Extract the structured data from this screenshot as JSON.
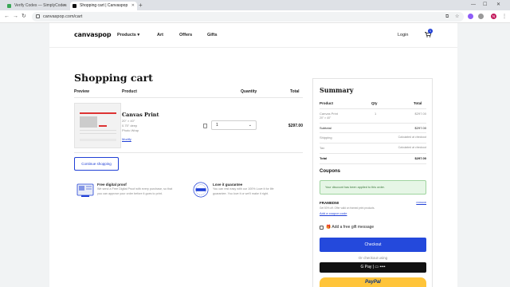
{
  "browser": {
    "tabs": [
      {
        "title": "Verify Codes — SimplyCodes",
        "active": false
      },
      {
        "title": "Shopping cart | Canvaspop",
        "active": true
      }
    ],
    "url": "canvaspop.com/cart",
    "profile_initial": "N"
  },
  "site": {
    "logo": "canvaspop",
    "nav": [
      "Products",
      "Art",
      "Offers",
      "Gifts"
    ],
    "login": "Login",
    "cart_count": "1"
  },
  "cart": {
    "title": "Shopping cart",
    "headers": {
      "preview": "Preview",
      "product": "Product",
      "quantity": "Quantity",
      "total": "Total"
    },
    "item": {
      "name": "Canvas Print",
      "size": "20\" × 40\"",
      "depth": "0.75\" deep",
      "wrap": "Photo Wrap",
      "modify": "Modify",
      "quantity": "1",
      "total": "$297.00"
    },
    "continue_label": "Continue shopping"
  },
  "features": [
    {
      "title": "Free digital proof",
      "line1": "We send a Free Digital Proof with every purchase, so that",
      "line2": "you can approve your order before it goes to print."
    },
    {
      "title": "Love it guarantee",
      "line1": "You can rest easy with our 100% Love it for life",
      "line2": "guarantee. You love it or we'll make it right."
    }
  ],
  "summary": {
    "title": "Summary",
    "headers": {
      "product": "Product",
      "qty": "Qty",
      "total": "Total"
    },
    "item": {
      "name": "Canvas Print",
      "size": "20\" × 40\"",
      "qty": "1",
      "total": "$297.00"
    },
    "subtotal_label": "Subtotal",
    "subtotal": "$297.00",
    "shipping_label": "Shipping",
    "shipping": "Calculated at checkout",
    "tax_label": "Tax",
    "tax": "Calculated at checkout",
    "total_label": "Total",
    "total": "$297.00"
  },
  "coupons": {
    "title": "Coupons",
    "alert": "Your discount has been applied to this order.",
    "code": "FRAMED50",
    "remove": "remove",
    "description": "Get 50% off. Offer valid on framed print products.",
    "add_link": "Add a coupon code"
  },
  "gift_label": "Add a free gift message",
  "checkout_label": "Checkout",
  "or_checkout": "Or checkout using",
  "gpay_label": "G Pay | ▭ ••••",
  "paypal_label": "PayPal",
  "colors": {
    "brand_blue": "#2449dc",
    "paypal_yellow": "#ffc439",
    "alert_green": "#e6f6e6"
  }
}
